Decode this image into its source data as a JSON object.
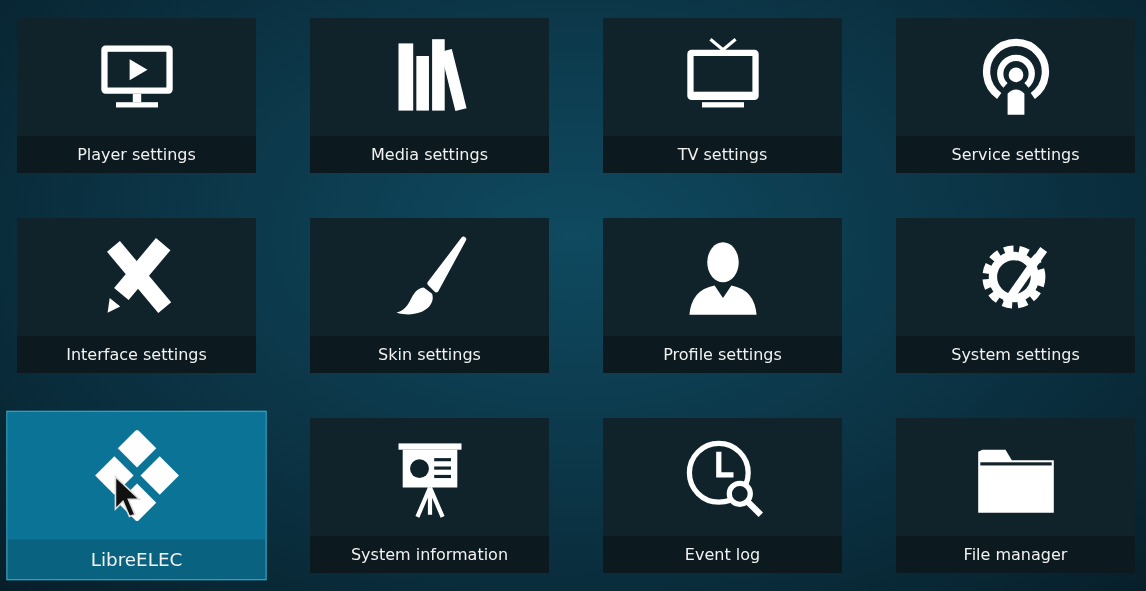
{
  "tiles": [
    {
      "label": "Player settings",
      "selected": false,
      "pointer_over": false
    },
    {
      "label": "Media settings",
      "selected": false,
      "pointer_over": false
    },
    {
      "label": "TV settings",
      "selected": false,
      "pointer_over": false
    },
    {
      "label": "Service settings",
      "selected": false,
      "pointer_over": false
    },
    {
      "label": "Interface settings",
      "selected": false,
      "pointer_over": false
    },
    {
      "label": "Skin settings",
      "selected": false,
      "pointer_over": false
    },
    {
      "label": "Profile settings",
      "selected": false,
      "pointer_over": false
    },
    {
      "label": "System settings",
      "selected": false,
      "pointer_over": false
    },
    {
      "label": "LibreELEC",
      "selected": true,
      "pointer_over": true
    },
    {
      "label": "System information",
      "selected": false,
      "pointer_over": false
    },
    {
      "label": "Event log",
      "selected": false,
      "pointer_over": false
    },
    {
      "label": "File manager",
      "selected": false,
      "pointer_over": false
    }
  ]
}
